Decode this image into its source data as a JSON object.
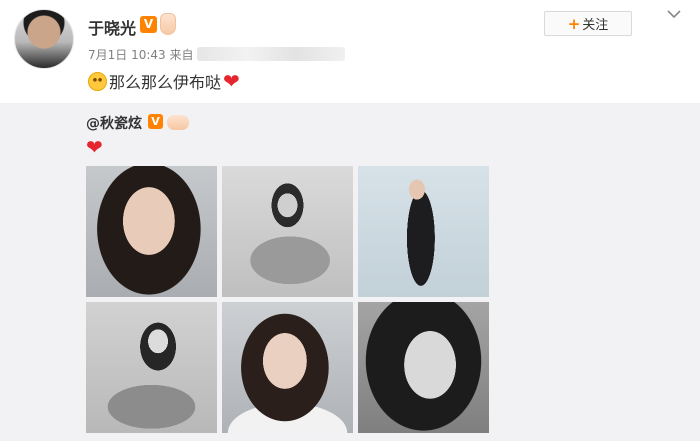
{
  "post": {
    "author": "于晓光",
    "verified_badge": "V",
    "date": "7月1日",
    "time": "10:43",
    "source_prefix": "来自",
    "text": "那么那么伊布哒",
    "follow_label": "关注",
    "follow_plus": "+",
    "menu_icon": "chevron-down-icon"
  },
  "repost": {
    "author": "@秋瓷炫",
    "verified_badge": "V",
    "photos": [
      {
        "icon": "photo"
      },
      {
        "icon": "photo"
      },
      {
        "icon": "photo"
      },
      {
        "icon": "photo"
      },
      {
        "icon": "photo"
      },
      {
        "icon": "photo"
      }
    ]
  },
  "colors": {
    "brand_orange": "#ff8200",
    "heart_red": "#e6262e",
    "repost_bg": "#f2f2f5",
    "meta_gray": "#808080"
  }
}
